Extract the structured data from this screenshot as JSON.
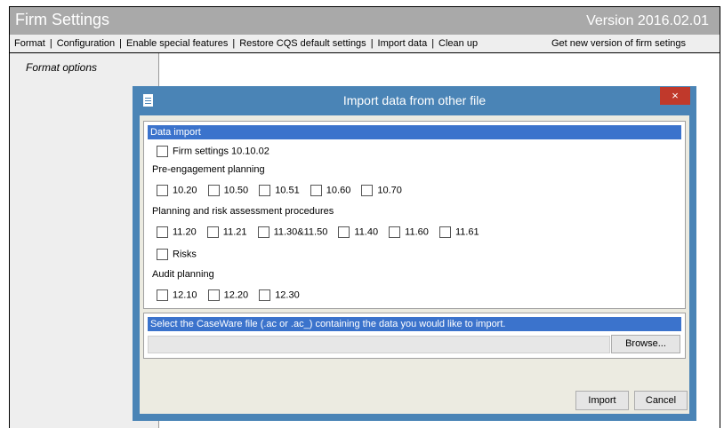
{
  "window": {
    "title": "Firm Settings",
    "version": "Version 2016.02.01"
  },
  "menubar": {
    "items": [
      "Format",
      "Configuration",
      "Enable special features",
      "Restore CQS default settings",
      "Import data",
      "Clean up"
    ],
    "separator": "|",
    "right_item": "Get new version of firm setings"
  },
  "sidebar": {
    "label": "Format options"
  },
  "dialog": {
    "title": "Import data from other file",
    "close_glyph": "×",
    "data_import": {
      "header": "Data import",
      "firm_settings": "Firm settings 10.10.02",
      "groups": [
        {
          "label": "Pre-engagement planning",
          "items": [
            "10.20",
            "10.50",
            "10.51",
            "10.60",
            "10.70"
          ]
        },
        {
          "label": "Planning and risk assessment procedures",
          "items": [
            "11.20",
            "11.21",
            "11.30&11.50",
            "11.40",
            "11.60",
            "11.61"
          ]
        },
        {
          "label": "Audit planning",
          "items": [
            "12.10",
            "12.20",
            "12.30"
          ]
        }
      ],
      "risks": "Risks"
    },
    "file_select": {
      "header": "Select the CaseWare file (.ac or .ac_) containing the data you would like to import.",
      "value": "",
      "browse_label": "Browse..."
    },
    "buttons": {
      "import": "Import",
      "cancel": "Cancel"
    }
  },
  "colors": {
    "titlebar": "#a9a9a9",
    "dialog_frame": "#4a84b6",
    "section_header": "#3b73cc",
    "close_button": "#c0392b",
    "dialog_body": "#ecebe1"
  }
}
